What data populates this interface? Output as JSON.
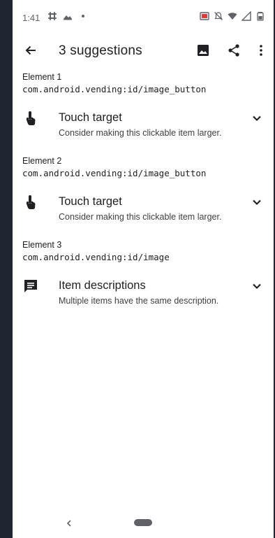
{
  "status_bar": {
    "time": "1:41",
    "left_icons": [
      "slack-icon",
      "photos-icon",
      "dot-icon"
    ],
    "right_icons": [
      "cast-icon",
      "bell-off-icon",
      "wifi-icon",
      "signal-icon",
      "battery-icon"
    ]
  },
  "app_bar": {
    "title": "3 suggestions",
    "actions": [
      "image-icon",
      "share-icon",
      "more-vert-icon"
    ]
  },
  "suggestions": [
    {
      "element_label": "Element 1",
      "element_id": "com.android.vending:id/image_button",
      "icon": "touch-icon",
      "title": "Touch target",
      "description": "Consider making this clickable item larger."
    },
    {
      "element_label": "Element 2",
      "element_id": "com.android.vending:id/image_button",
      "icon": "touch-icon",
      "title": "Touch target",
      "description": "Consider making this clickable item larger."
    },
    {
      "element_label": "Element 3",
      "element_id": "com.android.vending:id/image",
      "icon": "comment-icon",
      "title": "Item descriptions",
      "description": "Multiple items have the same description."
    }
  ],
  "colors": {
    "background": "#1f2631",
    "surface": "#ffffff",
    "text": "#202124",
    "icon": "#202124"
  }
}
